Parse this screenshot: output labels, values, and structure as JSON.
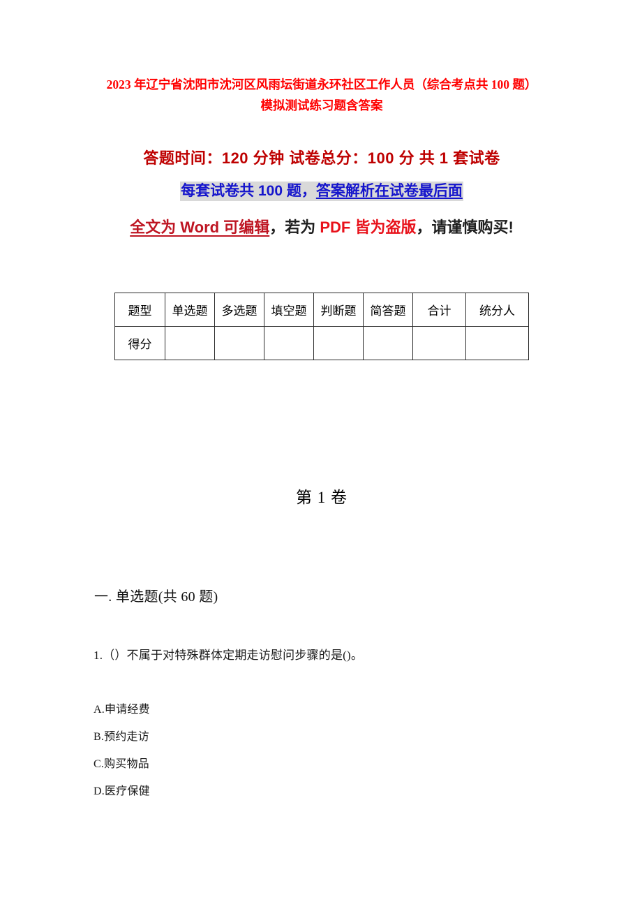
{
  "document": {
    "title": "2023 年辽宁省沈阳市沈河区风雨坛街道永环社区工作人员（综合考点共 100 题）模拟测试练习题含答案",
    "subtitle_exam_info": "答题时间：120 分钟    试卷总分：100 分    共 1 套试卷",
    "subtitle_count_prefix": "每套试卷共 100 题，",
    "subtitle_count_underlined": "答案解析在试卷最后面",
    "warning_word_editable": "全文为 Word 可编辑",
    "warning_sep1": "，若为 ",
    "warning_pdf_pirated": "PDF 皆为盗版",
    "warning_sep2": "，请谨慎购买!",
    "volume_heading": "第 1 卷",
    "section_heading": "一. 单选题(共 60 题)"
  },
  "colors": {
    "title_red": "#FF0000",
    "time_red": "#BE0000",
    "count_blue": "#1515CC",
    "count_highlight": "#D9D9D9",
    "word_red": "#BE1522",
    "pdf_red": "#E8121B",
    "text_black": "#1a1a1a",
    "table_border": "#2b2b2b",
    "page_background": "#ffffff"
  },
  "score_table": {
    "headers": [
      "题型",
      "单选题",
      "多选题",
      "填空题",
      "判断题",
      "简答题",
      "合计",
      "统分人"
    ],
    "rows": [
      {
        "label": "得分",
        "cells": [
          "",
          "",
          "",
          "",
          "",
          "",
          ""
        ]
      }
    ]
  },
  "questions": [
    {
      "number": "1.",
      "text": "1.（）不属于对特殊群体定期走访慰问步骤的是()。",
      "options": [
        "A.申请经费",
        "B.预约走访",
        "C.购买物品",
        "D.医疗保健"
      ]
    }
  ]
}
